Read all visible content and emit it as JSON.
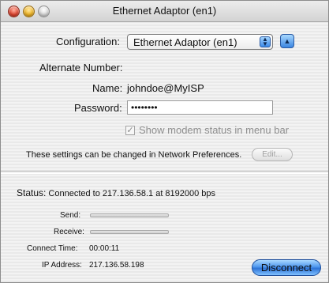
{
  "window": {
    "title": "Ethernet Adaptor (en1)",
    "controls": [
      "close",
      "minimize",
      "zoom"
    ]
  },
  "settings": {
    "configuration_label": "Configuration:",
    "configuration_value": "Ethernet Adaptor (en1)",
    "alternate_number_label": "Alternate Number:",
    "name_label": "Name:",
    "name_value": "johndoe@MyISP",
    "password_label": "Password:",
    "password_value": "••••••••",
    "show_status_label": "Show modem status in menu bar",
    "show_status_checked": true,
    "note": "These settings can be changed in Network Preferences.",
    "edit_label": "Edit..."
  },
  "status": {
    "label": "Status:",
    "text": "Connected to 217.136.58.1 at 8192000 bps",
    "send_label": "Send:",
    "send_level": 0,
    "receive_label": "Receive:",
    "receive_level": 0,
    "connect_time_label": "Connect Time:",
    "connect_time_value": "00:00:11",
    "ip_label": "IP Address:",
    "ip_value": "217.136.58.198",
    "disconnect_label": "Disconnect"
  }
}
